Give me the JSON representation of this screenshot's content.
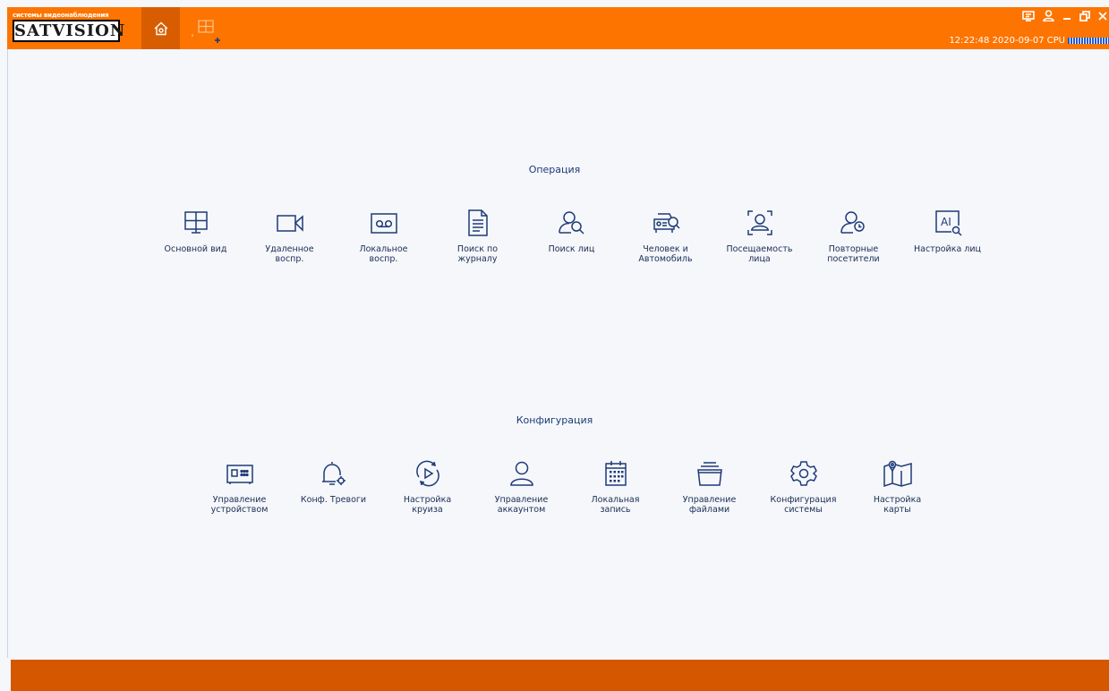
{
  "header": {
    "logo_top": "системы видеонаблюдения",
    "logo_main": "SATVISION",
    "datetime": "12:22:48 2020-09-07",
    "cpu_label": "CPU",
    "home_tab_icon": "home-icon",
    "view_tab_icon": "grid-view-icon",
    "window_controls": [
      "monitor-icon",
      "user-icon",
      "minimize-icon",
      "restore-icon",
      "close-icon"
    ]
  },
  "sections": {
    "operation": {
      "title": "Операция",
      "items": [
        {
          "label": "Основной вид",
          "icon": "live-view-icon"
        },
        {
          "label": "Удаленное\nвоспр.",
          "icon": "camera-icon"
        },
        {
          "label": "Локальное\nвоспр.",
          "icon": "tape-icon"
        },
        {
          "label": "Поиск по\nжурналу",
          "icon": "log-icon"
        },
        {
          "label": "Поиск лиц",
          "icon": "face-search-icon"
        },
        {
          "label": "Человек и\nАвтомобиль",
          "icon": "car-search-icon"
        },
        {
          "label": "Посещаемость\nлица",
          "icon": "face-frame-icon"
        },
        {
          "label": "Повторные\nпосетители",
          "icon": "repeat-visitor-icon"
        },
        {
          "label": "Настройка лиц",
          "icon": "ai-icon"
        }
      ]
    },
    "configuration": {
      "title": "Конфигурация",
      "items": [
        {
          "label": "Управление\nустройством",
          "icon": "device-icon"
        },
        {
          "label": "Конф. Тревоги",
          "icon": "alarm-bell-icon"
        },
        {
          "label": "Настройка\nкруиза",
          "icon": "cruise-icon"
        },
        {
          "label": "Управление\nаккаунтом",
          "icon": "account-icon"
        },
        {
          "label": "Локальная\nзапись",
          "icon": "calendar-icon"
        },
        {
          "label": "Управление\nфайлами",
          "icon": "files-icon"
        },
        {
          "label": "Конфигурация\nсистемы",
          "icon": "gear-icon"
        },
        {
          "label": "Настройка\nкарты",
          "icon": "map-icon"
        }
      ]
    }
  },
  "colors": {
    "topbar": "#fd7400",
    "bottombar": "#d55700",
    "icon": "#1f3a78",
    "background": "#f5f7fa"
  }
}
